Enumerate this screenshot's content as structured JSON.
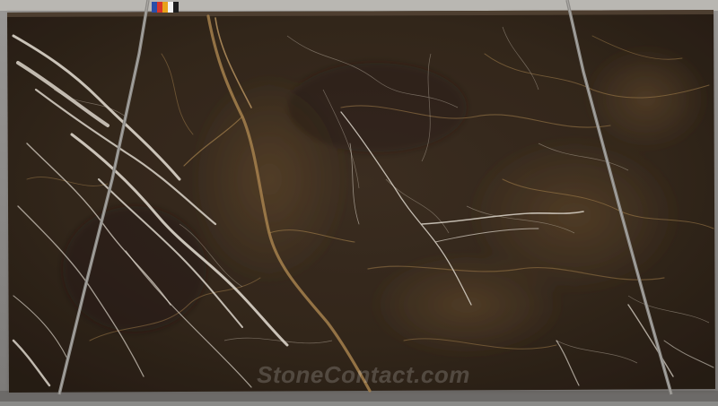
{
  "photo": {
    "subject": "marble slab",
    "watermark": "StoneContact.com"
  },
  "colors": {
    "slab_base": "#3a2c1e",
    "slab_dark": "#2a1f15",
    "gold_vein": "#b08a52",
    "white_vein": "#ece6da",
    "background": "#8a8a88"
  }
}
